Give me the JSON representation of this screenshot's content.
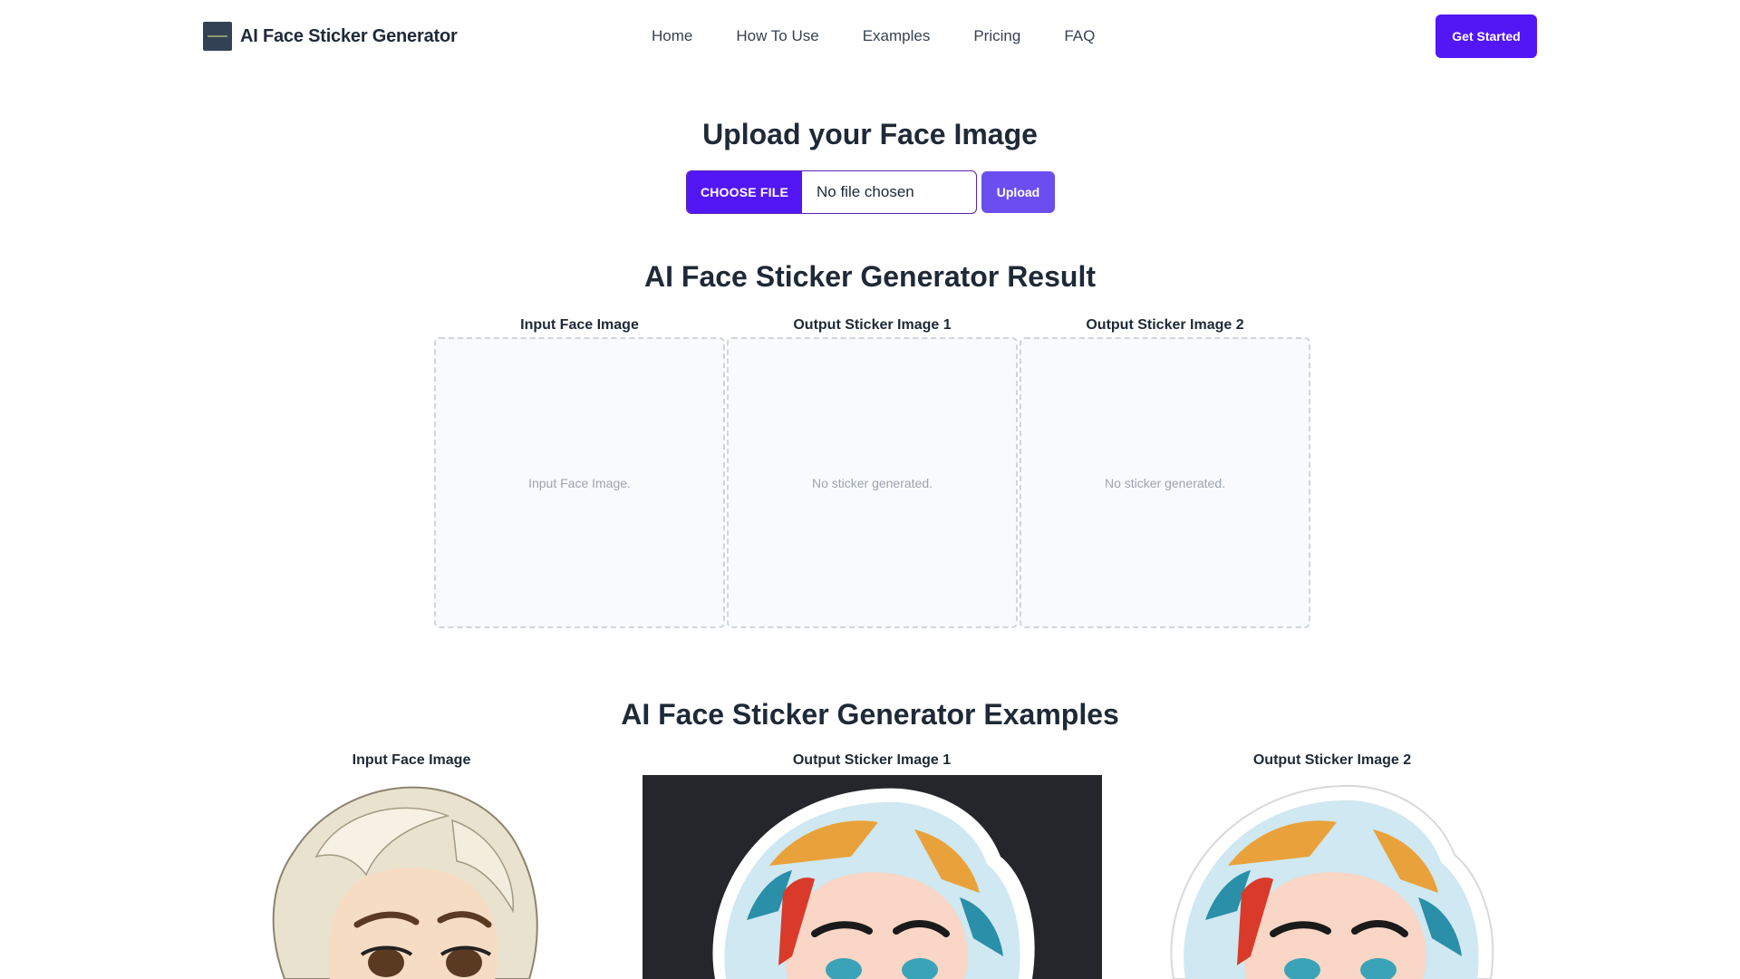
{
  "header": {
    "brand_name": "AI Face Sticker Generator",
    "nav": [
      "Home",
      "How To Use",
      "Examples",
      "Pricing",
      "FAQ"
    ],
    "cta_label": "Get Started"
  },
  "upload": {
    "title": "Upload your Face Image",
    "choose_file_label": "CHOOSE FILE",
    "file_status": "No file chosen",
    "upload_label": "Upload"
  },
  "result": {
    "title": "AI Face Sticker Generator Result",
    "columns": [
      {
        "label": "Input Face Image",
        "placeholder": "Input Face Image."
      },
      {
        "label": "Output Sticker Image 1",
        "placeholder": "No sticker generated."
      },
      {
        "label": "Output Sticker Image 2",
        "placeholder": "No sticker generated."
      }
    ]
  },
  "examples": {
    "title": "AI Face Sticker Generator Examples",
    "columns": [
      {
        "label": "Input Face Image"
      },
      {
        "label": "Output Sticker Image 1"
      },
      {
        "label": "Output Sticker Image 2"
      }
    ]
  },
  "colors": {
    "accent": "#5316f5",
    "upload_button": "#6b4ef0",
    "placeholder_border": "#d1d5db",
    "placeholder_bg": "#f9fafb",
    "example_dark_bg": "#25262b"
  }
}
